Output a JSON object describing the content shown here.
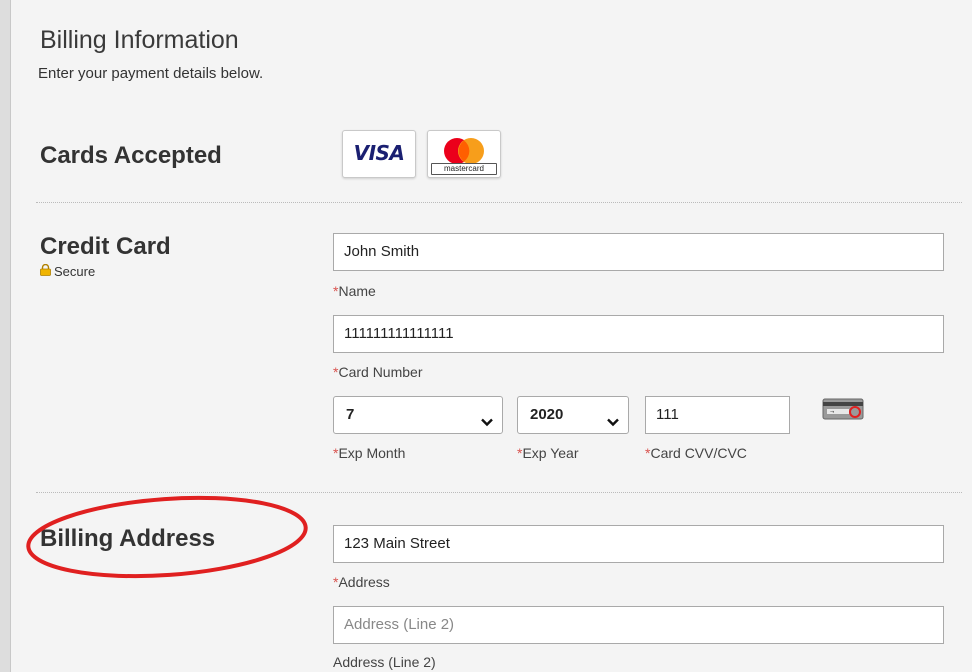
{
  "page": {
    "title": "Billing Information",
    "subtitle": "Enter your payment details below."
  },
  "cards_accepted": {
    "title": "Cards Accepted",
    "visa": "VISA",
    "mastercard": "mastercard"
  },
  "credit_card": {
    "title": "Credit Card",
    "secure_label": "Secure",
    "name_value": "John Smith",
    "name_label": "Name",
    "number_value": "111111111111111",
    "number_label": "Card Number",
    "exp_month_value": "7",
    "exp_month_label": "Exp Month",
    "exp_year_value": "2020",
    "exp_year_label": "Exp Year",
    "cvv_value": "111",
    "cvv_label": "Card CVV/CVC",
    "required_mark": "*"
  },
  "billing_address": {
    "title": "Billing Address",
    "address_value": "123 Main Street",
    "address_label": "Address",
    "address2_placeholder": "Address (Line 2)",
    "address2_label": "Address (Line 2)"
  },
  "colors": {
    "required": "#d9534f",
    "annotation": "#e02020",
    "visa_blue": "#1a1f71"
  }
}
